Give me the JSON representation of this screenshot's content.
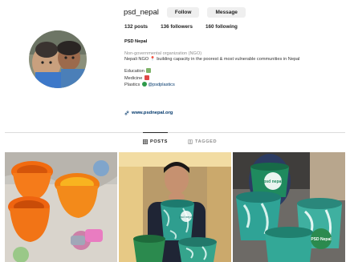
{
  "profile": {
    "username": "psd_nepal",
    "follow_label": "Follow",
    "message_label": "Message",
    "stats": {
      "posts": "132 posts",
      "followers": "136 followers",
      "following": "160 following"
    },
    "display_name": "PSD Nepal",
    "category": "Non-governmental organization (NGO)",
    "bio_lines": [
      "Nepali NGO 📍 building capacity in the poorest & most vulnerable communities in Nepal",
      "Education",
      "Medicine",
      "Plastics"
    ],
    "plastics_handle": "@psdplastics",
    "website": "www.psdnepal.org"
  },
  "tabs": {
    "posts_label": "POSTS",
    "tagged_label": "TAGGED"
  },
  "post_overlay_text": {
    "post2": "psd nepal",
    "post3a": "psd nepal",
    "post3b": "PSD Nepal"
  },
  "colors": {
    "link": "#00376b",
    "button_bg": "#efefef",
    "divider": "#dbdbdb",
    "pot_teal": "#2f9e8f",
    "pot_green": "#2b8a4e",
    "pot_orange": "#f26b0f"
  },
  "icons": {
    "posts_tab": "grid-icon",
    "tagged_tab": "tag-icon",
    "website": "link-icon"
  }
}
